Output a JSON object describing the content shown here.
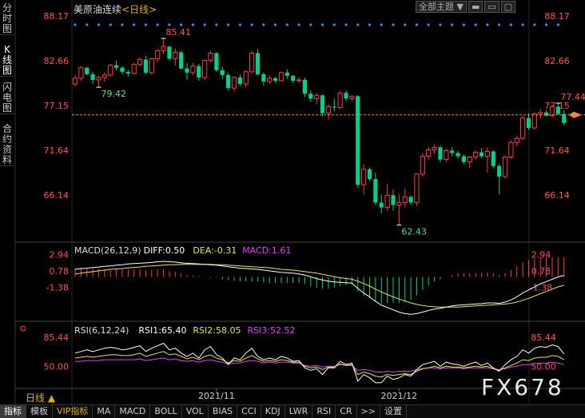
{
  "header": {
    "title": "美原油连续",
    "period_tag": "<日线>"
  },
  "left_tabs": [
    {
      "label": "分时图",
      "active": false
    },
    {
      "label": "K线图",
      "active": true
    },
    {
      "label": "闪电图",
      "active": false
    },
    {
      "label": "合约资料",
      "active": false
    }
  ],
  "toolbar": {
    "theme_label": "全部主题",
    "dropdown_glyph": "▼"
  },
  "period_label": "日线 ▲",
  "watermark": "FX678",
  "bottom_tabs": [
    "指标",
    "模板",
    "VIP指标",
    "MA",
    "MACD",
    "BOLL",
    "VOL",
    "BIAS",
    "CCI",
    "KDJ",
    "LWR",
    "RSI",
    "CR",
    ">>",
    "设置"
  ],
  "colors": {
    "up": "#ff3b3b",
    "down": "#00d08a",
    "diff": "#ffffff",
    "dea": "#e6e64c",
    "macd": "#e040fb",
    "last_price": "#ff8a2a",
    "axis_label": "#ff5050"
  },
  "chart_data": [
    {
      "type": "candlestick",
      "title": "美原油连续 <日线>",
      "ylim": [
        62.0,
        88.17
      ],
      "yticks": [
        88.17,
        82.66,
        77.15,
        71.64,
        66.14
      ],
      "xticks": [
        {
          "label": "2021/11",
          "index": 24
        },
        {
          "label": "2021/12",
          "index": 55
        }
      ],
      "annotations": [
        {
          "label": "85.41",
          "index": 15
        },
        {
          "label": "79.42",
          "index": 4
        },
        {
          "label": "62.43",
          "index": 55
        },
        {
          "label": "77.44",
          "index": 82
        }
      ],
      "last_price": 76.0,
      "candles": [
        [
          79.8,
          80.9,
          79.5,
          80.5
        ],
        [
          80.5,
          82.0,
          80.2,
          81.8
        ],
        [
          81.8,
          81.9,
          80.9,
          81.0
        ],
        [
          81.0,
          81.3,
          79.8,
          80.3
        ],
        [
          80.3,
          80.8,
          79.4,
          80.6
        ],
        [
          80.6,
          81.2,
          80.1,
          80.9
        ],
        [
          80.9,
          82.3,
          80.7,
          82.1
        ],
        [
          82.1,
          82.7,
          81.5,
          81.8
        ],
        [
          81.8,
          82.0,
          81.0,
          81.3
        ],
        [
          81.3,
          81.5,
          80.7,
          81.1
        ],
        [
          81.1,
          82.4,
          81.0,
          82.2
        ],
        [
          82.2,
          83.1,
          82.0,
          82.8
        ],
        [
          82.8,
          83.3,
          81.0,
          81.2
        ],
        [
          81.2,
          83.0,
          81.0,
          82.9
        ],
        [
          82.9,
          84.1,
          82.5,
          83.9
        ],
        [
          83.9,
          85.41,
          83.5,
          84.4
        ],
        [
          84.4,
          84.5,
          82.7,
          82.9
        ],
        [
          82.9,
          84.2,
          82.1,
          83.7
        ],
        [
          83.7,
          83.9,
          81.6,
          81.7
        ],
        [
          81.7,
          82.4,
          80.3,
          81.2
        ],
        [
          81.2,
          82.4,
          80.9,
          82.0
        ],
        [
          82.0,
          82.3,
          80.2,
          80.6
        ],
        [
          80.6,
          82.8,
          80.3,
          82.7
        ],
        [
          82.7,
          83.9,
          82.5,
          83.6
        ],
        [
          83.6,
          83.7,
          81.3,
          81.5
        ],
        [
          81.5,
          81.9,
          80.4,
          80.9
        ],
        [
          80.9,
          81.2,
          79.0,
          79.3
        ],
        [
          79.3,
          80.8,
          78.9,
          80.6
        ],
        [
          80.6,
          81.0,
          79.5,
          79.8
        ],
        [
          79.8,
          81.5,
          79.4,
          81.3
        ],
        [
          81.3,
          83.9,
          81.1,
          83.6
        ],
        [
          83.6,
          84.1,
          80.8,
          81.0
        ],
        [
          81.0,
          81.2,
          79.6,
          80.1
        ],
        [
          80.1,
          80.9,
          79.8,
          80.5
        ],
        [
          80.5,
          80.7,
          79.9,
          80.2
        ],
        [
          80.2,
          81.3,
          80.1,
          81.2
        ],
        [
          81.2,
          81.6,
          80.4,
          80.8
        ],
        [
          80.8,
          80.9,
          79.9,
          80.2
        ],
        [
          80.2,
          80.6,
          79.9,
          80.3
        ],
        [
          80.3,
          80.6,
          78.2,
          78.6
        ],
        [
          78.6,
          79.0,
          77.6,
          78.0
        ],
        [
          78.0,
          78.7,
          77.3,
          78.4
        ],
        [
          78.4,
          78.5,
          75.8,
          76.2
        ],
        [
          76.2,
          77.3,
          75.4,
          77.0
        ],
        [
          77.0,
          78.0,
          76.4,
          76.9
        ],
        [
          76.9,
          78.9,
          76.7,
          78.7
        ],
        [
          78.7,
          79.0,
          77.7,
          78.0
        ],
        [
          78.0,
          78.4,
          77.7,
          78.3
        ],
        [
          78.3,
          78.4,
          67.0,
          67.4
        ],
        [
          67.4,
          69.9,
          66.2,
          69.3
        ],
        [
          69.3,
          69.5,
          67.9,
          68.1
        ],
        [
          68.1,
          68.9,
          64.9,
          65.2
        ],
        [
          65.2,
          66.2,
          63.9,
          64.6
        ],
        [
          64.6,
          67.5,
          64.2,
          66.1
        ],
        [
          66.1,
          66.8,
          64.2,
          64.9
        ],
        [
          64.9,
          66.2,
          62.43,
          65.2
        ],
        [
          65.2,
          66.9,
          64.6,
          65.9
        ],
        [
          65.9,
          66.1,
          64.9,
          65.2
        ],
        [
          65.2,
          68.8,
          64.8,
          68.7
        ],
        [
          68.7,
          71.3,
          68.4,
          70.9
        ],
        [
          70.9,
          72.1,
          70.5,
          71.7
        ],
        [
          71.7,
          72.4,
          71.2,
          72.0
        ],
        [
          72.0,
          72.2,
          70.2,
          70.5
        ],
        [
          70.5,
          71.8,
          70.2,
          71.6
        ],
        [
          71.6,
          72.0,
          70.9,
          71.3
        ],
        [
          71.3,
          71.6,
          70.6,
          70.9
        ],
        [
          70.9,
          71.1,
          69.9,
          70.2
        ],
        [
          70.2,
          70.9,
          69.5,
          70.8
        ],
        [
          70.8,
          71.6,
          70.5,
          71.4
        ],
        [
          71.4,
          71.9,
          70.7,
          70.9
        ],
        [
          70.9,
          72.0,
          68.9,
          71.5
        ],
        [
          71.5,
          71.7,
          69.4,
          69.7
        ],
        [
          69.7,
          70.0,
          66.2,
          68.4
        ],
        [
          68.4,
          71.0,
          68.2,
          70.8
        ],
        [
          70.8,
          72.9,
          70.6,
          72.6
        ],
        [
          72.6,
          73.4,
          72.1,
          73.1
        ],
        [
          73.1,
          75.9,
          72.9,
          75.6
        ],
        [
          75.6,
          76.2,
          74.1,
          74.4
        ],
        [
          74.4,
          76.3,
          74.2,
          76.1
        ],
        [
          76.1,
          76.7,
          75.5,
          76.3
        ],
        [
          76.3,
          76.6,
          75.8,
          75.9
        ],
        [
          75.9,
          77.2,
          75.7,
          77.0
        ],
        [
          77.0,
          77.44,
          76.0,
          76.1
        ],
        [
          76.1,
          76.6,
          74.7,
          75.0
        ]
      ],
      "top_dots": {
        "up_count": 10,
        "down_count": 23
      }
    },
    {
      "type": "macd",
      "legend": {
        "name": "MACD(26,12,9)",
        "diff": "DIFF:0.50",
        "dea": "DEA:-0.31",
        "macd": "MACD:1.61"
      },
      "ylim": [
        -5.6,
        3.2
      ],
      "yticks": [
        2.94,
        0.78,
        -1.38
      ],
      "diff": [
        1.0,
        1.1,
        1.15,
        1.25,
        1.3,
        1.4,
        1.45,
        1.55,
        1.6,
        1.7,
        1.75,
        1.8,
        1.85,
        1.9,
        2.0,
        2.05,
        2.0,
        1.95,
        1.85,
        1.8,
        1.75,
        1.7,
        1.65,
        1.6,
        1.55,
        1.45,
        1.35,
        1.25,
        1.15,
        1.1,
        1.05,
        1.0,
        0.9,
        0.8,
        0.7,
        0.6,
        0.55,
        0.5,
        0.4,
        0.25,
        0.0,
        -0.2,
        -0.4,
        -0.55,
        -0.65,
        -0.7,
        -0.75,
        -0.8,
        -1.5,
        -2.1,
        -2.6,
        -3.2,
        -3.7,
        -4.0,
        -4.3,
        -4.6,
        -4.8,
        -4.9,
        -4.8,
        -4.6,
        -4.4,
        -4.2,
        -4.1,
        -3.95,
        -3.8,
        -3.7,
        -3.65,
        -3.6,
        -3.55,
        -3.5,
        -3.4,
        -3.4,
        -3.45,
        -3.3,
        -3.0,
        -2.6,
        -2.1,
        -1.7,
        -1.3,
        -0.9,
        -0.6,
        -0.3,
        0.0,
        0.2
      ],
      "dea": [
        0.4,
        0.5,
        0.6,
        0.7,
        0.8,
        0.9,
        1.0,
        1.05,
        1.1,
        1.2,
        1.25,
        1.3,
        1.4,
        1.45,
        1.5,
        1.55,
        1.6,
        1.6,
        1.65,
        1.65,
        1.65,
        1.65,
        1.65,
        1.65,
        1.6,
        1.6,
        1.55,
        1.5,
        1.45,
        1.4,
        1.35,
        1.3,
        1.25,
        1.2,
        1.1,
        1.0,
        0.95,
        0.9,
        0.8,
        0.7,
        0.6,
        0.5,
        0.35,
        0.2,
        0.05,
        -0.1,
        -0.2,
        -0.3,
        -0.55,
        -0.85,
        -1.2,
        -1.6,
        -1.95,
        -2.3,
        -2.6,
        -2.9,
        -3.15,
        -3.4,
        -3.6,
        -3.75,
        -3.85,
        -3.9,
        -3.95,
        -3.95,
        -3.95,
        -3.95,
        -3.9,
        -3.85,
        -3.8,
        -3.75,
        -3.7,
        -3.65,
        -3.6,
        -3.55,
        -3.45,
        -3.3,
        -3.05,
        -2.8,
        -2.5,
        -2.2,
        -1.9,
        -1.6,
        -1.3,
        -1.1
      ],
      "macd_bars": [
        1.2,
        1.2,
        1.1,
        1.1,
        1.0,
        1.0,
        0.9,
        1.0,
        1.0,
        1.0,
        1.0,
        1.0,
        0.9,
        0.9,
        1.0,
        1.0,
        0.8,
        0.7,
        0.4,
        0.3,
        0.2,
        0.1,
        0.0,
        -0.1,
        -0.1,
        -0.3,
        -0.4,
        -0.5,
        -0.6,
        -0.6,
        -0.6,
        -0.6,
        -0.7,
        -0.8,
        -0.8,
        -0.8,
        -0.8,
        -0.8,
        -0.8,
        -0.9,
        -1.2,
        -1.4,
        -1.5,
        -1.5,
        -1.4,
        -1.2,
        -1.1,
        -1.0,
        -1.9,
        -2.5,
        -2.8,
        -3.2,
        -3.5,
        -3.4,
        -3.4,
        -3.4,
        -3.3,
        -3.0,
        -2.4,
        -1.7,
        -1.1,
        -0.6,
        -0.3,
        0.0,
        0.3,
        0.5,
        0.5,
        0.5,
        0.5,
        0.5,
        0.6,
        0.5,
        0.3,
        0.5,
        0.9,
        1.4,
        1.9,
        2.2,
        2.4,
        2.6,
        2.6,
        2.6,
        2.6,
        2.6
      ]
    },
    {
      "type": "rsi",
      "legend": {
        "name": "RSI(6,12,24)",
        "rsi1": "RSI1:65.40",
        "rsi2": "RSI2:58.05",
        "rsi3": "RSI3:52.52"
      },
      "ylim": [
        25,
        95
      ],
      "yticks": [
        85.44,
        50.0
      ],
      "rsi1": [
        66,
        68,
        70,
        68,
        70,
        72,
        73,
        72,
        70,
        71,
        73,
        75,
        68,
        72,
        75,
        78,
        70,
        72,
        66,
        62,
        66,
        60,
        70,
        74,
        64,
        60,
        52,
        60,
        58,
        66,
        72,
        62,
        58,
        60,
        58,
        62,
        60,
        56,
        57,
        48,
        45,
        47,
        40,
        48,
        48,
        56,
        52,
        54,
        32,
        40,
        36,
        30,
        30,
        38,
        34,
        36,
        40,
        38,
        46,
        52,
        54,
        56,
        50,
        55,
        53,
        52,
        50,
        53,
        55,
        51,
        54,
        48,
        44,
        52,
        58,
        62,
        70,
        66,
        72,
        74,
        73,
        76,
        74,
        65
      ],
      "rsi2": [
        60,
        61,
        62,
        61,
        62,
        63,
        64,
        64,
        63,
        63,
        64,
        66,
        62,
        64,
        66,
        68,
        64,
        65,
        62,
        59,
        61,
        58,
        62,
        64,
        60,
        58,
        54,
        57,
        56,
        60,
        63,
        59,
        56,
        57,
        56,
        58,
        57,
        55,
        55,
        50,
        48,
        49,
        46,
        49,
        49,
        53,
        51,
        52,
        40,
        43,
        41,
        38,
        37,
        40,
        39,
        40,
        41,
        40,
        44,
        47,
        48,
        50,
        48,
        50,
        49,
        49,
        48,
        49,
        50,
        49,
        50,
        47,
        45,
        48,
        51,
        54,
        58,
        57,
        60,
        61,
        61,
        63,
        62,
        58
      ],
      "rsi3": [
        56,
        56,
        57,
        57,
        57,
        58,
        58,
        58,
        58,
        58,
        58,
        59,
        57,
        58,
        59,
        60,
        58,
        59,
        57,
        56,
        57,
        55,
        57,
        58,
        56,
        55,
        53,
        54,
        54,
        56,
        57,
        56,
        54,
        55,
        54,
        55,
        55,
        54,
        54,
        51,
        50,
        51,
        49,
        50,
        50,
        52,
        51,
        51,
        45,
        46,
        45,
        43,
        43,
        44,
        43,
        44,
        44,
        44,
        46,
        47,
        48,
        48,
        47,
        48,
        48,
        48,
        47,
        48,
        48,
        48,
        48,
        47,
        46,
        47,
        49,
        50,
        52,
        52,
        53,
        54,
        54,
        55,
        54,
        52
      ]
    }
  ]
}
